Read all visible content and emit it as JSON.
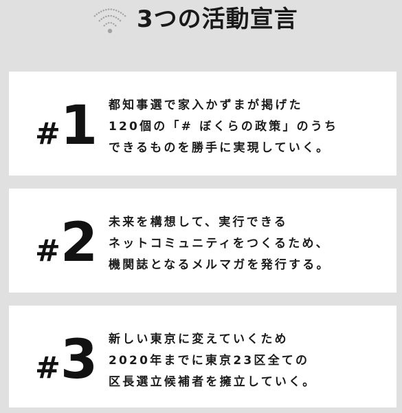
{
  "header": {
    "title": "3つの活動宣言",
    "icon": "wifi-icon"
  },
  "declarations": [
    {
      "hash": "#",
      "number": "1",
      "lines": [
        "都知事選で家入かずまが掲げた",
        "120個の「# ぼくらの政策」のうち",
        "できるものを勝手に実現していく。"
      ]
    },
    {
      "hash": "#",
      "number": "2",
      "lines": [
        "未来を構想して、実行できる",
        "ネットコミュニティをつくるため、",
        "機関誌となるメルマガを発行する。"
      ]
    },
    {
      "hash": "#",
      "number": "3",
      "lines": [
        "新しい東京に変えていくため",
        "2020年までに東京23区全ての",
        "区長選立候補者を擁立していく。"
      ]
    }
  ],
  "colors": {
    "background": "#e0e0e0",
    "card": "#ffffff",
    "text": "#111111",
    "icon": "#9a9a9a"
  }
}
